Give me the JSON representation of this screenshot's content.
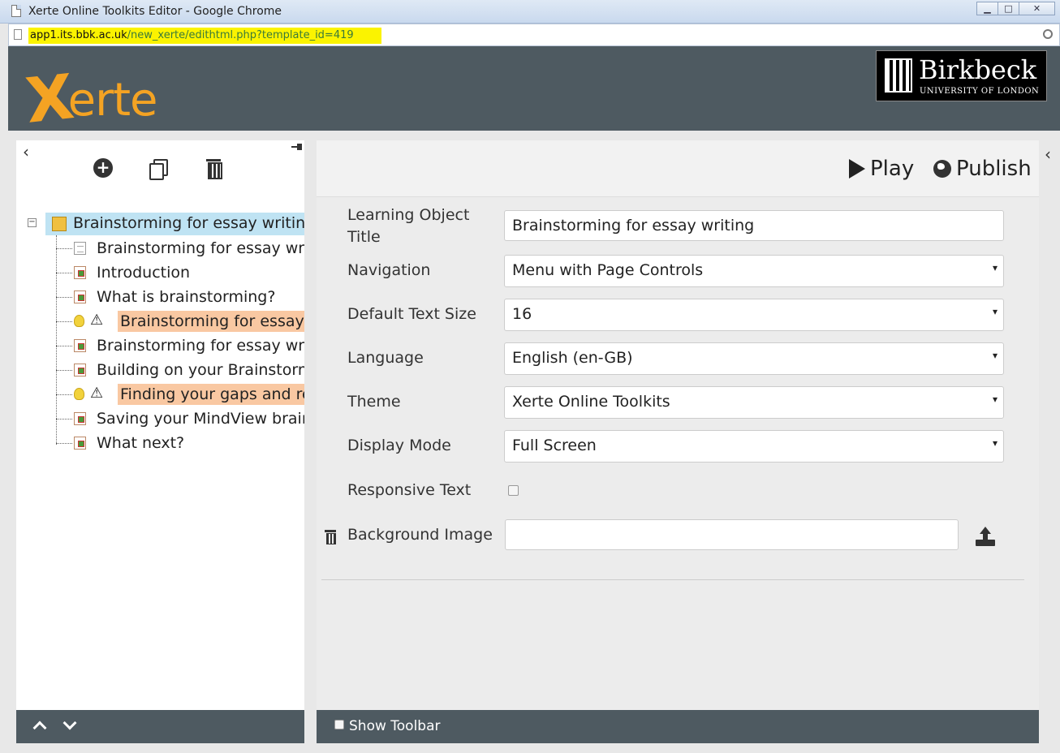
{
  "window": {
    "title": "Xerte Online Toolkits Editor - Google Chrome",
    "min": "▁",
    "max": "□",
    "close": "✕"
  },
  "address": {
    "host": "app1.its.bbk.ac.uk",
    "path": "/new_xerte/edithtml.php?template_id=419"
  },
  "header": {
    "logo_x": "X",
    "logo_rest": "erte",
    "brand_name": "Birkbeck",
    "brand_sub": "UNIVERSITY OF LONDON"
  },
  "left": {
    "collapse": "‹",
    "add": "+",
    "tree": {
      "root": "Brainstorming for essay writing",
      "expander": "−",
      "nodes": [
        {
          "label": "Brainstorming for essay writing",
          "icon": "text-page-icon"
        },
        {
          "label": "Introduction",
          "icon": "page-icon"
        },
        {
          "label": "What is brainstorming?",
          "icon": "page-icon"
        },
        {
          "label": "Brainstorming for essay writing",
          "icon": "bulb-icon",
          "warn": true
        },
        {
          "label": "Brainstorming for essay writing",
          "icon": "page-icon"
        },
        {
          "label": "Building on your Brainstorm",
          "icon": "page-icon"
        },
        {
          "label": "Finding your gaps and research",
          "icon": "bulb-icon",
          "warn": true
        },
        {
          "label": "Saving your MindView brainstorm",
          "icon": "page-icon"
        },
        {
          "label": "What next?",
          "icon": "page-icon"
        }
      ],
      "warn_symbol": "⚠"
    }
  },
  "main": {
    "play": "Play",
    "publish": "Publish",
    "form": {
      "title_label": "Learning Object Title",
      "title_value": "Brainstorming for essay writing",
      "navigation_label": "Navigation",
      "navigation_value": "Menu with Page Controls",
      "text_size_label": "Default Text Size",
      "text_size_value": "16",
      "language_label": "Language",
      "language_value": "English (en-GB)",
      "theme_label": "Theme",
      "theme_value": "Xerte Online Toolkits",
      "display_mode_label": "Display Mode",
      "display_mode_value": "Full Screen",
      "responsive_label": "Responsive Text",
      "background_label": "Background Image",
      "background_value": ""
    },
    "show_toolbar": "Show Toolbar"
  },
  "right": {
    "collapse": "‹"
  },
  "colors": {
    "header": "#4e5a61",
    "accent": "#f4a323",
    "highlight": "#f7f300",
    "warn_bg": "#f9c8a2",
    "root_bg": "#bfe3f3"
  }
}
